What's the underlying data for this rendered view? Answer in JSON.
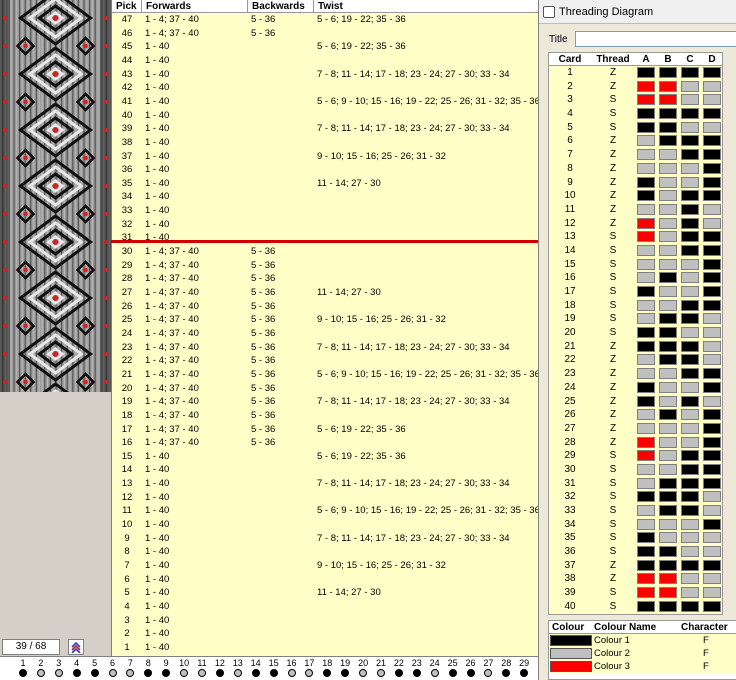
{
  "status": {
    "counter": "39 / 68"
  },
  "table": {
    "headers": {
      "pick": "Pick",
      "forwards": "Forwards",
      "backwards": "Backwards",
      "twist": "Twist"
    },
    "rows": [
      {
        "pick": "47",
        "fwd": "1 - 4; 37 - 40",
        "bwd": "5 - 36",
        "twist": "5 - 6; 19 - 22; 35 - 36"
      },
      {
        "pick": "46",
        "fwd": "1 - 4; 37 - 40",
        "bwd": "5 - 36",
        "twist": ""
      },
      {
        "pick": "45",
        "fwd": "1 - 40",
        "bwd": "",
        "twist": "5 - 6; 19 - 22; 35 - 36"
      },
      {
        "pick": "44",
        "fwd": "1 - 40",
        "bwd": "",
        "twist": ""
      },
      {
        "pick": "43",
        "fwd": "1 - 40",
        "bwd": "",
        "twist": "7 - 8; 11 - 14; 17 - 18; 23 - 24; 27 - 30; 33 - 34"
      },
      {
        "pick": "42",
        "fwd": "1 - 40",
        "bwd": "",
        "twist": ""
      },
      {
        "pick": "41",
        "fwd": "1 - 40",
        "bwd": "",
        "twist": "5 - 6; 9 - 10; 15 - 16; 19 - 22; 25 - 26; 31 - 32; 35 - 36"
      },
      {
        "pick": "40",
        "fwd": "1 - 40",
        "bwd": "",
        "twist": ""
      },
      {
        "pick": "39",
        "fwd": "1 - 40",
        "bwd": "",
        "twist": "7 - 8; 11 - 14; 17 - 18; 23 - 24; 27 - 30; 33 - 34"
      },
      {
        "pick": "38",
        "fwd": "1 - 40",
        "bwd": "",
        "twist": ""
      },
      {
        "pick": "37",
        "fwd": "1 - 40",
        "bwd": "",
        "twist": "9 - 10; 15 - 16; 25 - 26; 31 - 32"
      },
      {
        "pick": "36",
        "fwd": "1 - 40",
        "bwd": "",
        "twist": ""
      },
      {
        "pick": "35",
        "fwd": "1 - 40",
        "bwd": "",
        "twist": "11 - 14; 27 - 30"
      },
      {
        "pick": "34",
        "fwd": "1 - 40",
        "bwd": "",
        "twist": ""
      },
      {
        "pick": "33",
        "fwd": "1 - 40",
        "bwd": "",
        "twist": ""
      },
      {
        "pick": "32",
        "fwd": "1 - 40",
        "bwd": "",
        "twist": ""
      },
      {
        "pick": "31",
        "fwd": "1 - 40",
        "bwd": "",
        "twist": ""
      },
      {
        "pick": "30",
        "fwd": "1 - 4; 37 - 40",
        "bwd": "5 - 36",
        "twist": ""
      },
      {
        "pick": "29",
        "fwd": "1 - 4; 37 - 40",
        "bwd": "5 - 36",
        "twist": ""
      },
      {
        "pick": "28",
        "fwd": "1 - 4; 37 - 40",
        "bwd": "5 - 36",
        "twist": ""
      },
      {
        "pick": "27",
        "fwd": "1 - 4; 37 - 40",
        "bwd": "5 - 36",
        "twist": "11 - 14; 27 - 30"
      },
      {
        "pick": "26",
        "fwd": "1 - 4; 37 - 40",
        "bwd": "5 - 36",
        "twist": ""
      },
      {
        "pick": "25",
        "fwd": "1 - 4; 37 - 40",
        "bwd": "5 - 36",
        "twist": "9 - 10; 15 - 16; 25 - 26; 31 - 32"
      },
      {
        "pick": "24",
        "fwd": "1 - 4; 37 - 40",
        "bwd": "5 - 36",
        "twist": ""
      },
      {
        "pick": "23",
        "fwd": "1 - 4; 37 - 40",
        "bwd": "5 - 36",
        "twist": "7 - 8; 11 - 14; 17 - 18; 23 - 24; 27 - 30; 33 - 34"
      },
      {
        "pick": "22",
        "fwd": "1 - 4; 37 - 40",
        "bwd": "5 - 36",
        "twist": ""
      },
      {
        "pick": "21",
        "fwd": "1 - 4; 37 - 40",
        "bwd": "5 - 36",
        "twist": "5 - 6; 9 - 10; 15 - 16; 19 - 22; 25 - 26; 31 - 32; 35 - 36"
      },
      {
        "pick": "20",
        "fwd": "1 - 4; 37 - 40",
        "bwd": "5 - 36",
        "twist": ""
      },
      {
        "pick": "19",
        "fwd": "1 - 4; 37 - 40",
        "bwd": "5 - 36",
        "twist": "7 - 8; 11 - 14; 17 - 18; 23 - 24; 27 - 30; 33 - 34"
      },
      {
        "pick": "18",
        "fwd": "1 - 4; 37 - 40",
        "bwd": "5 - 36",
        "twist": ""
      },
      {
        "pick": "17",
        "fwd": "1 - 4; 37 - 40",
        "bwd": "5 - 36",
        "twist": "5 - 6; 19 - 22; 35 - 36"
      },
      {
        "pick": "16",
        "fwd": "1 - 4; 37 - 40",
        "bwd": "5 - 36",
        "twist": ""
      },
      {
        "pick": "15",
        "fwd": "1 - 40",
        "bwd": "",
        "twist": "5 - 6; 19 - 22; 35 - 36"
      },
      {
        "pick": "14",
        "fwd": "1 - 40",
        "bwd": "",
        "twist": ""
      },
      {
        "pick": "13",
        "fwd": "1 - 40",
        "bwd": "",
        "twist": "7 - 8; 11 - 14; 17 - 18; 23 - 24; 27 - 30; 33 - 34"
      },
      {
        "pick": "12",
        "fwd": "1 - 40",
        "bwd": "",
        "twist": ""
      },
      {
        "pick": "11",
        "fwd": "1 - 40",
        "bwd": "",
        "twist": "5 - 6; 9 - 10; 15 - 16; 19 - 22; 25 - 26; 31 - 32; 35 - 36"
      },
      {
        "pick": "10",
        "fwd": "1 - 40",
        "bwd": "",
        "twist": ""
      },
      {
        "pick": "9",
        "fwd": "1 - 40",
        "bwd": "",
        "twist": "7 - 8; 11 - 14; 17 - 18; 23 - 24; 27 - 30; 33 - 34"
      },
      {
        "pick": "8",
        "fwd": "1 - 40",
        "bwd": "",
        "twist": ""
      },
      {
        "pick": "7",
        "fwd": "1 - 40",
        "bwd": "",
        "twist": "9 - 10; 15 - 16; 25 - 26; 31 - 32"
      },
      {
        "pick": "6",
        "fwd": "1 - 40",
        "bwd": "",
        "twist": ""
      },
      {
        "pick": "5",
        "fwd": "1 - 40",
        "bwd": "",
        "twist": "11 - 14; 27 - 30"
      },
      {
        "pick": "4",
        "fwd": "1 - 40",
        "bwd": "",
        "twist": ""
      },
      {
        "pick": "3",
        "fwd": "1 - 40",
        "bwd": "",
        "twist": ""
      },
      {
        "pick": "2",
        "fwd": "1 - 40",
        "bwd": "",
        "twist": ""
      },
      {
        "pick": "1",
        "fwd": "1 - 40",
        "bwd": "",
        "twist": ""
      }
    ]
  },
  "bottom_strip": [
    {
      "n": "1",
      "c": "b"
    },
    {
      "n": "2",
      "c": "g"
    },
    {
      "n": "3",
      "c": "g"
    },
    {
      "n": "4",
      "c": "b"
    },
    {
      "n": "5",
      "c": "b"
    },
    {
      "n": "6",
      "c": "g"
    },
    {
      "n": "7",
      "c": "g"
    },
    {
      "n": "8",
      "c": "b"
    },
    {
      "n": "9",
      "c": "b"
    },
    {
      "n": "10",
      "c": "g"
    },
    {
      "n": "11",
      "c": "g"
    },
    {
      "n": "12",
      "c": "b"
    },
    {
      "n": "13",
      "c": "g"
    },
    {
      "n": "14",
      "c": "b"
    },
    {
      "n": "15",
      "c": "b"
    },
    {
      "n": "16",
      "c": "g"
    },
    {
      "n": "17",
      "c": "g"
    },
    {
      "n": "18",
      "c": "b"
    },
    {
      "n": "19",
      "c": "b"
    },
    {
      "n": "20",
      "c": "g"
    },
    {
      "n": "21",
      "c": "g"
    },
    {
      "n": "22",
      "c": "b"
    },
    {
      "n": "23",
      "c": "b"
    },
    {
      "n": "24",
      "c": "g"
    },
    {
      "n": "25",
      "c": "b"
    },
    {
      "n": "26",
      "c": "b"
    },
    {
      "n": "27",
      "c": "g"
    },
    {
      "n": "28",
      "c": "b"
    },
    {
      "n": "29",
      "c": "b"
    }
  ],
  "diagram": {
    "window_title": "Threading Diagram",
    "title_label": "Title",
    "title_value": "",
    "headers": {
      "card": "Card",
      "thread": "Thread",
      "a": "A",
      "b": "B",
      "c": "C",
      "d": "D"
    },
    "cards": [
      {
        "card": "1",
        "thread": "Z",
        "holes": "1111"
      },
      {
        "card": "2",
        "thread": "Z",
        "holes": "3322"
      },
      {
        "card": "3",
        "thread": "S",
        "holes": "3322"
      },
      {
        "card": "4",
        "thread": "S",
        "holes": "1111"
      },
      {
        "card": "5",
        "thread": "S",
        "holes": "1122"
      },
      {
        "card": "6",
        "thread": "Z",
        "holes": "2111"
      },
      {
        "card": "7",
        "thread": "Z",
        "holes": "2211"
      },
      {
        "card": "8",
        "thread": "Z",
        "holes": "2221"
      },
      {
        "card": "9",
        "thread": "Z",
        "holes": "1221"
      },
      {
        "card": "10",
        "thread": "Z",
        "holes": "1211"
      },
      {
        "card": "11",
        "thread": "Z",
        "holes": "2212"
      },
      {
        "card": "12",
        "thread": "Z",
        "holes": "3212"
      },
      {
        "card": "13",
        "thread": "S",
        "holes": "3211"
      },
      {
        "card": "14",
        "thread": "S",
        "holes": "2211"
      },
      {
        "card": "15",
        "thread": "S",
        "holes": "2221"
      },
      {
        "card": "16",
        "thread": "S",
        "holes": "2121"
      },
      {
        "card": "17",
        "thread": "S",
        "holes": "1221"
      },
      {
        "card": "18",
        "thread": "S",
        "holes": "2211"
      },
      {
        "card": "19",
        "thread": "S",
        "holes": "2112"
      },
      {
        "card": "20",
        "thread": "S",
        "holes": "1122"
      },
      {
        "card": "21",
        "thread": "Z",
        "holes": "1112"
      },
      {
        "card": "22",
        "thread": "Z",
        "holes": "2112"
      },
      {
        "card": "23",
        "thread": "Z",
        "holes": "2211"
      },
      {
        "card": "24",
        "thread": "Z",
        "holes": "1221"
      },
      {
        "card": "25",
        "thread": "Z",
        "holes": "1212"
      },
      {
        "card": "26",
        "thread": "Z",
        "holes": "2121"
      },
      {
        "card": "27",
        "thread": "Z",
        "holes": "2221"
      },
      {
        "card": "28",
        "thread": "Z",
        "holes": "3221"
      },
      {
        "card": "29",
        "thread": "S",
        "holes": "3211"
      },
      {
        "card": "30",
        "thread": "S",
        "holes": "2211"
      },
      {
        "card": "31",
        "thread": "S",
        "holes": "2111"
      },
      {
        "card": "32",
        "thread": "S",
        "holes": "1112"
      },
      {
        "card": "33",
        "thread": "S",
        "holes": "2112"
      },
      {
        "card": "34",
        "thread": "S",
        "holes": "2221"
      },
      {
        "card": "35",
        "thread": "S",
        "holes": "1222"
      },
      {
        "card": "36",
        "thread": "S",
        "holes": "1122"
      },
      {
        "card": "37",
        "thread": "Z",
        "holes": "1111"
      },
      {
        "card": "38",
        "thread": "Z",
        "holes": "3322"
      },
      {
        "card": "39",
        "thread": "S",
        "holes": "3322"
      },
      {
        "card": "40",
        "thread": "S",
        "holes": "1111"
      }
    ],
    "palette": {
      "1": "#000000",
      "2": "#c0c0c0",
      "3": "#ff0000"
    }
  },
  "colours": {
    "headers": {
      "colour": "Colour",
      "name": "Colour Name",
      "character": "Character"
    },
    "rows": [
      {
        "name": "Colour 1",
        "character": "F",
        "hex": "#000000"
      },
      {
        "name": "Colour 2",
        "character": "F",
        "hex": "#c0c0c0"
      },
      {
        "name": "Colour 3",
        "character": "F",
        "hex": "#ff0000"
      }
    ]
  }
}
